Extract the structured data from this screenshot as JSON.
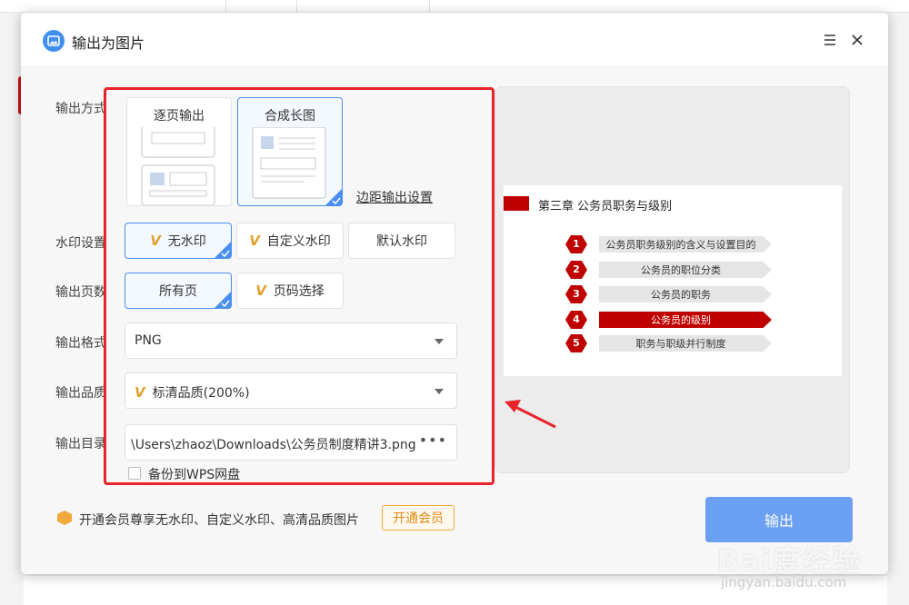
{
  "dialog": {
    "title": "输出为图片"
  },
  "labels": {
    "output_mode": "输出方式",
    "watermark": "水印设置",
    "pages": "输出页数",
    "format": "输出格式",
    "quality": "输出品质",
    "directory": "输出目录"
  },
  "output_modes": [
    {
      "label": "逐页输出",
      "selected": false
    },
    {
      "label": "合成长图",
      "selected": true
    }
  ],
  "margin_link": "边距输出设置",
  "watermark_options": [
    {
      "label": "无水印",
      "vip": true,
      "selected": true
    },
    {
      "label": "自定义水印",
      "vip": true,
      "selected": false
    },
    {
      "label": "默认水印",
      "vip": false,
      "selected": false
    }
  ],
  "page_options": [
    {
      "label": "所有页",
      "selected": true
    },
    {
      "label": "页码选择",
      "vip": true,
      "selected": false
    }
  ],
  "format": {
    "value": "PNG"
  },
  "quality": {
    "value": "标清品质(200%)"
  },
  "directory": {
    "value": "\\Users\\zhaoz\\Downloads\\公务员制度精讲3.png",
    "more": "•••"
  },
  "backup": {
    "label": "备份到WPS网盘",
    "checked": false
  },
  "preview": {
    "slide_title": "第三章  公务员职务与级别",
    "items": [
      {
        "num": "1",
        "text": "公务员职务级别的含义与设置目的",
        "active": false
      },
      {
        "num": "2",
        "text": "公务员的职位分类",
        "active": false
      },
      {
        "num": "3",
        "text": "公务员的职务",
        "active": false
      },
      {
        "num": "4",
        "text": "公务员的级别",
        "active": true
      },
      {
        "num": "5",
        "text": "职务与职级并行制度",
        "active": false
      }
    ]
  },
  "footer": {
    "promo_text": "开通会员尊享无水印、自定义水印、高清品质图片",
    "vip_button": "开通会员",
    "export_button": "输出"
  },
  "watermark_text": {
    "brand": "Bai度经验",
    "url": "jingyan.baidu.com"
  },
  "colors": {
    "accent": "#4a8ff0",
    "annotation_red": "#e8242a",
    "slide_red": "#c00000",
    "vip_gold": "#f0a93a"
  }
}
